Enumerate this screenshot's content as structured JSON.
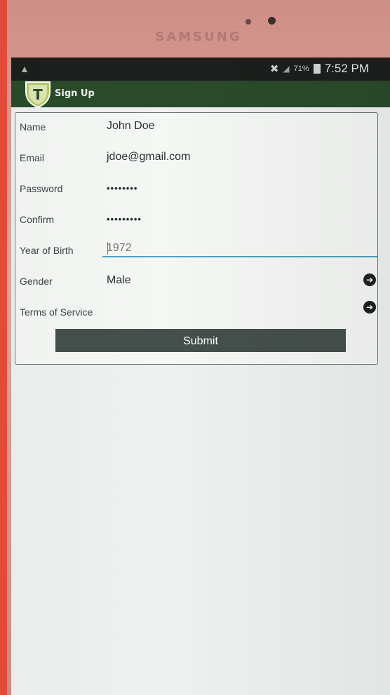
{
  "device": {
    "brand": "SAMSUNG"
  },
  "statusbar": {
    "battery": "71%",
    "time": "7:52 PM",
    "icons": [
      "notification-icon",
      "mute-icon",
      "signal-icon",
      "battery-icon"
    ]
  },
  "appbar": {
    "logo_letter": "T",
    "title": "Sign Up"
  },
  "form": {
    "name": {
      "label": "Name",
      "value": "John Doe"
    },
    "email": {
      "label": "Email",
      "value": "jdoe@gmail.com"
    },
    "password": {
      "label": "Password",
      "value": "••••••••"
    },
    "confirm": {
      "label": "Confirm",
      "value": "•••••••••"
    },
    "year_of_birth": {
      "label": "Year of Birth",
      "placeholder": "1972"
    },
    "gender": {
      "label": "Gender",
      "value": "Male"
    },
    "terms": {
      "label": "Terms of Service"
    },
    "submit_label": "Submit"
  },
  "colors": {
    "appbar": "#2a4b2a",
    "statusbar": "#1c1f1d",
    "accent_underline": "#4ea0bf",
    "submit": "#454f4c"
  }
}
